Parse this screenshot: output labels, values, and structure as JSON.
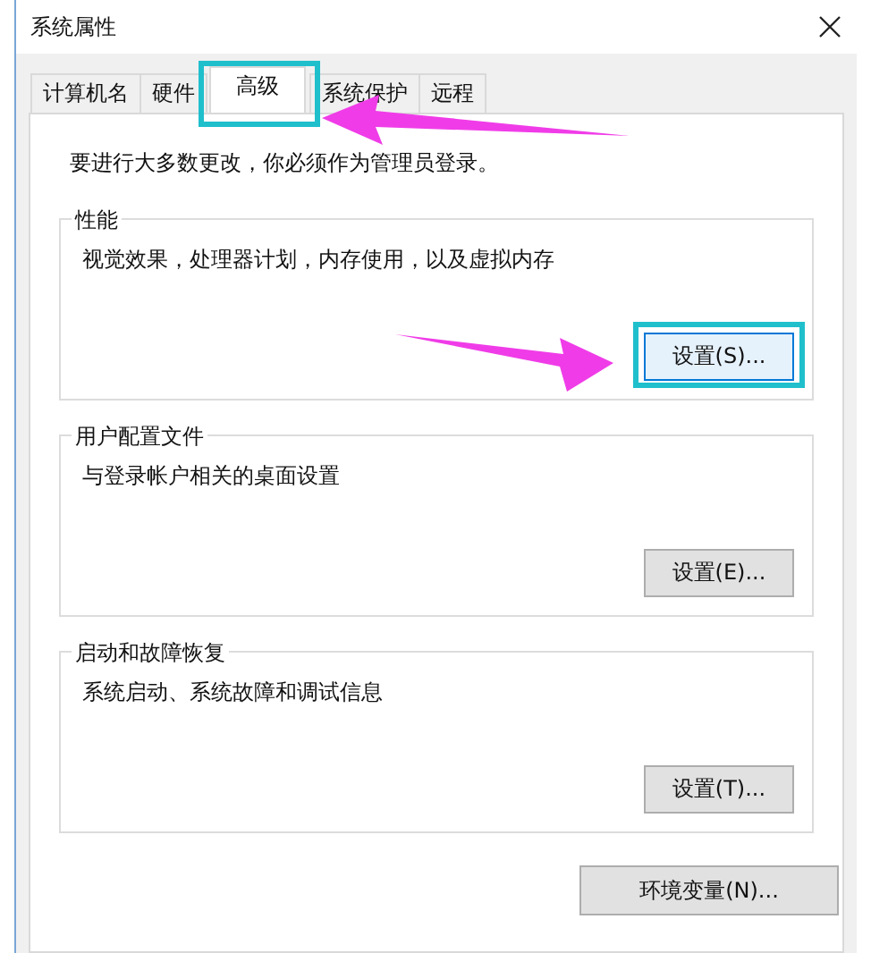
{
  "window": {
    "title": "系统属性"
  },
  "tabs": [
    {
      "label": "计算机名",
      "selected": false,
      "highlighted": false
    },
    {
      "label": "硬件",
      "selected": false,
      "highlighted": false
    },
    {
      "label": "高级",
      "selected": true,
      "highlighted": true
    },
    {
      "label": "系统保护",
      "selected": false,
      "highlighted": false
    },
    {
      "label": "远程",
      "selected": false,
      "highlighted": false
    }
  ],
  "notice": "要进行大多数更改，你必须作为管理员登录。",
  "groups": [
    {
      "title": "性能",
      "description": "视觉效果，处理器计划，内存使用，以及虚拟内存",
      "button": {
        "label": "设置(S)...",
        "highlighted": true
      }
    },
    {
      "title": "用户配置文件",
      "description": "与登录帐户相关的桌面设置",
      "button": {
        "label": "设置(E)...",
        "highlighted": false
      }
    },
    {
      "title": "启动和故障恢复",
      "description": "系统启动、系统故障和调试信息",
      "button": {
        "label": "设置(T)...",
        "highlighted": false
      }
    }
  ],
  "footer_button": {
    "label": "环境变量(N)..."
  }
}
